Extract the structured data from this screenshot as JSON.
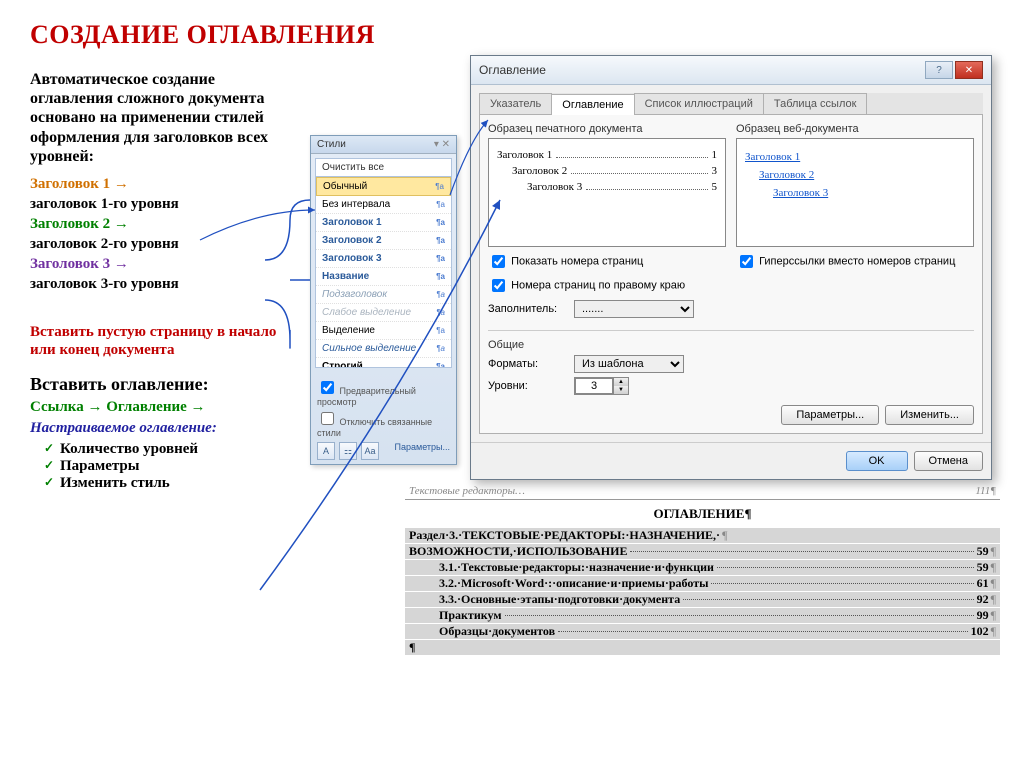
{
  "slide": {
    "title": "СОЗДАНИЕ ОГЛАВЛЕНИЯ",
    "intro": "Автоматическое создание оглавления сложного документа основано на применении стилей оформления для заголовков всех уровней:",
    "map": {
      "h1": "Заголовок 1 →",
      "h1d": "заголовок 1-го уровня",
      "h2": "Заголовок 2 →",
      "h2d": "заголовок 2-го уровня",
      "h3": "Заголовок 3 →",
      "h3d": "заголовок 3-го уровня"
    },
    "insert_note": "Вставить пустую страницу  в начало или  конец документа",
    "insert_toc": "Вставить оглавление:",
    "step_line": {
      "a": "Ссылка",
      "arrow": "→",
      "b": "Оглавление"
    },
    "custom": "Настраиваемое оглавление:",
    "bullets": [
      "Количество уровней",
      "Параметры",
      "Изменить стиль"
    ]
  },
  "styles_panel": {
    "title": "Стили",
    "clear": "Очистить все",
    "items": [
      {
        "label": "Обычный",
        "cls": "selected"
      },
      {
        "label": "Без интервала",
        "cls": ""
      },
      {
        "label": "Заголовок 1",
        "cls": "h1"
      },
      {
        "label": "Заголовок 2",
        "cls": "h2"
      },
      {
        "label": "Заголовок 3",
        "cls": "h3"
      },
      {
        "label": "Название",
        "cls": "name"
      },
      {
        "label": "Подзаголовок",
        "cls": "sub"
      },
      {
        "label": "Слабое выделение",
        "cls": "weak"
      },
      {
        "label": "Выделение",
        "cls": ""
      },
      {
        "label": "Сильное выделение",
        "cls": "strong"
      },
      {
        "label": "Строгий",
        "cls": "bld"
      }
    ],
    "preview_chk": "Предварительный просмотр",
    "disable_chk": "Отключить связанные стили",
    "params": "Параметры..."
  },
  "dialog": {
    "title": "Оглавление",
    "tabs": [
      "Указатель",
      "Оглавление",
      "Список иллюстраций",
      "Таблица ссылок"
    ],
    "active_tab": 1,
    "print_label": "Образец печатного документа",
    "web_label": "Образец веб-документа",
    "print_lines": [
      {
        "text": "Заголовок 1",
        "page": "1",
        "indent": 0
      },
      {
        "text": "Заголовок 2",
        "page": "3",
        "indent": 1
      },
      {
        "text": "Заголовок 3",
        "page": "5",
        "indent": 2
      }
    ],
    "web_lines": [
      "Заголовок 1",
      "Заголовок 2",
      "Заголовок 3"
    ],
    "show_pages": "Показать номера страниц",
    "right_align": "Номера страниц по правому краю",
    "hyperlinks": "Гиперссылки вместо номеров страниц",
    "filler_label": "Заполнитель:",
    "filler_value": ".......",
    "general_label": "Общие",
    "formats_label": "Форматы:",
    "formats_value": "Из шаблона",
    "levels_label": "Уровни:",
    "levels_value": "3",
    "params_btn": "Параметры...",
    "modify_btn": "Изменить...",
    "ok": "OK",
    "cancel": "Отмена"
  },
  "doc": {
    "header_left": "Текстовые редакторы…",
    "header_right": "111¶",
    "title": "ОГЛАВЛЕНИЕ¶",
    "lines": [
      {
        "text": "Раздел·3.·ТЕКСТОВЫЕ·РЕДАКТОРЫ:·НАЗНАЧЕНИЕ,·",
        "page": "",
        "sub": false,
        "tail": "¶"
      },
      {
        "text": "ВОЗМОЖНОСТИ,·ИСПОЛЬЗОВАНИЕ",
        "page": "59",
        "sub": false,
        "tail": "¶"
      },
      {
        "text": "3.1.·Текстовые·редакторы:·назначение·и·функции",
        "page": "59",
        "sub": true,
        "tail": "¶"
      },
      {
        "text": "3.2.·Microsoft·Word·:·описание·и·приемы·работы",
        "page": "61",
        "sub": true,
        "tail": "¶"
      },
      {
        "text": "3.3.·Основные·этапы·подготовки·документа",
        "page": "92",
        "sub": true,
        "tail": "¶"
      },
      {
        "text": "Практикум",
        "page": "99",
        "sub": true,
        "tail": "¶"
      },
      {
        "text": "Образцы·документов",
        "page": "102",
        "sub": true,
        "tail": "¶"
      }
    ],
    "pil": "¶"
  }
}
